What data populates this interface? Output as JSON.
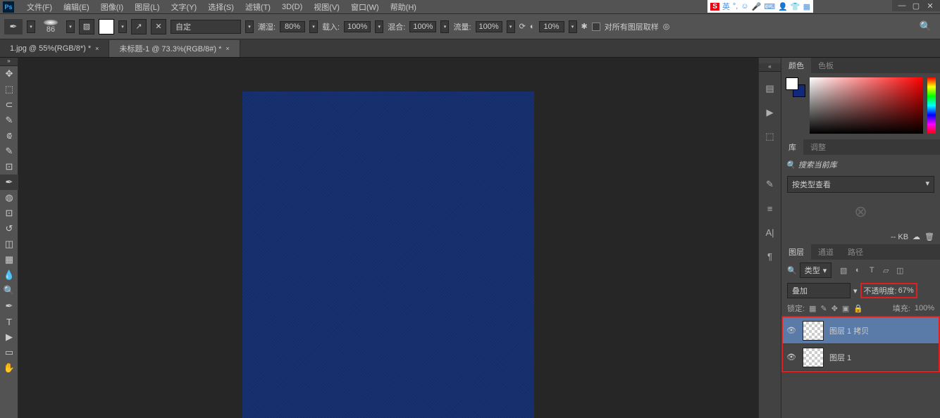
{
  "menu": {
    "items": [
      "文件(F)",
      "编辑(E)",
      "图像(I)",
      "图层(L)",
      "文字(Y)",
      "选择(S)",
      "滤镜(T)",
      "3D(D)",
      "视图(V)",
      "窗口(W)",
      "帮助(H)"
    ]
  },
  "ime": {
    "lang": "英"
  },
  "options": {
    "brush_size": "86",
    "mode_label": "自定",
    "flow_label": "潮湿:",
    "flow_val": "80%",
    "load_label": "载入:",
    "load_val": "100%",
    "mix_label": "混合:",
    "mix_val": "100%",
    "flow2_label": "流量:",
    "flow2_val": "100%",
    "smooth_val": "10%",
    "sample_all": "对所有图层取样"
  },
  "tabs": [
    {
      "title": "1.jpg @ 55%(RGB/8*) *"
    },
    {
      "title": "未标题-1 @ 73.3%(RGB/8#) *"
    }
  ],
  "color_tabs": {
    "a": "颜色",
    "b": "色板"
  },
  "lib_tabs": {
    "a": "库",
    "b": "调整"
  },
  "lib": {
    "search_ph": "搜索当前库",
    "view": "按类型查看",
    "size": "-- KB"
  },
  "layer_tabs": {
    "a": "图层",
    "b": "通道",
    "c": "路径"
  },
  "layer_filter": {
    "kind": "类型"
  },
  "blend": {
    "mode": "叠加",
    "opacity_label": "不透明度:",
    "opacity_val": "67%"
  },
  "lock": {
    "label": "锁定:",
    "fill_label": "填充:",
    "fill_val": "100%"
  },
  "layers": [
    {
      "name": "图层 1 拷贝"
    },
    {
      "name": "图层 1"
    }
  ]
}
